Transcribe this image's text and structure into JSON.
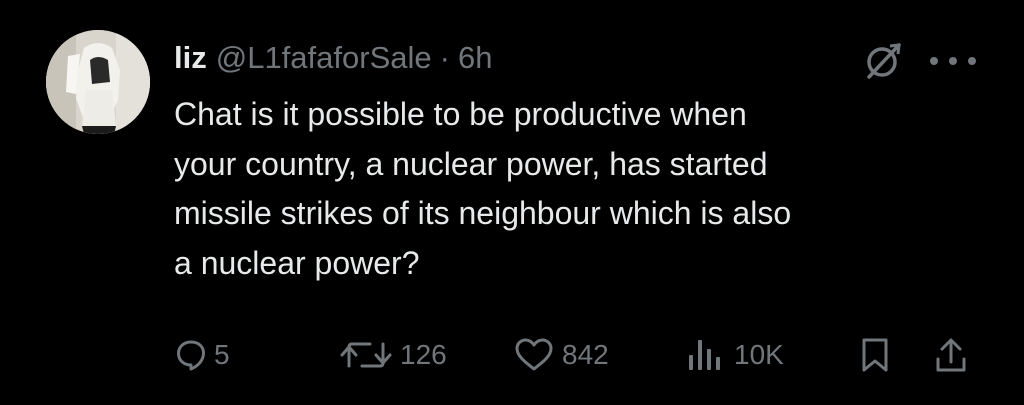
{
  "author": {
    "display_name": "liz",
    "handle": "@L1fafaforSale",
    "separator": "·",
    "time": "6h"
  },
  "tweet": {
    "lines": [
      "Chat is it possible to be productive when",
      "your country, a nuclear power, has started",
      "missile strikes of its neighbour which is also",
      "a nuclear power?"
    ]
  },
  "stats": {
    "replies": "5",
    "reposts": "126",
    "likes": "842",
    "views": "10K"
  },
  "icons": {
    "reply": "reply-icon",
    "repost": "repost-icon",
    "like": "heart-icon",
    "views": "views-icon",
    "bookmark": "bookmark-icon",
    "share": "share-icon",
    "grok": "grok-icon",
    "more": "more-icon"
  },
  "colors": {
    "background": "#000000",
    "text": "#e7e9ea",
    "muted": "#71767b"
  }
}
